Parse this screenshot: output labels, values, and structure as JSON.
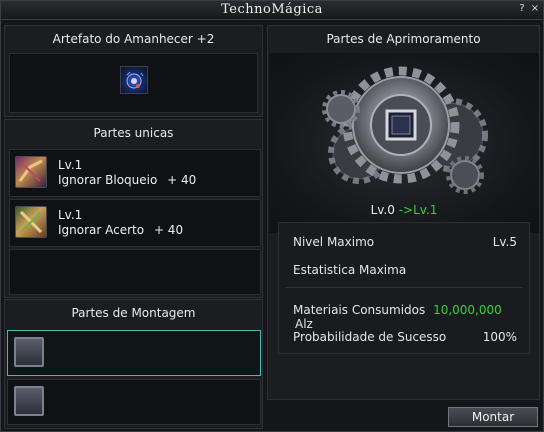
{
  "window": {
    "title": "TechnoMágica",
    "help_label": "?",
    "close_label": "×"
  },
  "artifact": {
    "title": "Artefato do Amanhecer +2"
  },
  "unique_parts": {
    "title": "Partes unicas",
    "items": [
      {
        "level": "Lv.1",
        "stat": "Ignorar Bloqueio",
        "value": "+ 40"
      },
      {
        "level": "Lv.1",
        "stat": "Ignorar Acerto",
        "value": "+ 40"
      }
    ]
  },
  "mount_parts": {
    "title": "Partes de Montagem"
  },
  "upgrade_parts": {
    "title": "Partes de Aprimoramento",
    "level_from": "Lv.0",
    "arrow": "->",
    "level_to": "Lv.1"
  },
  "stats": {
    "max_level_label": "Nivel Maximo",
    "max_level_value": "Lv.5",
    "max_stat_label": "Estatistica Maxima",
    "materials_label": "Materiais Consumidos",
    "materials_value": "10,000,000",
    "materials_unit": "Alz",
    "success_label": "Probabilidade de Sucesso",
    "success_value": "100%"
  },
  "actions": {
    "mount_label": "Montar"
  },
  "colors": {
    "accent_green": "#37d13a",
    "selected_border": "#4fb7b0"
  }
}
